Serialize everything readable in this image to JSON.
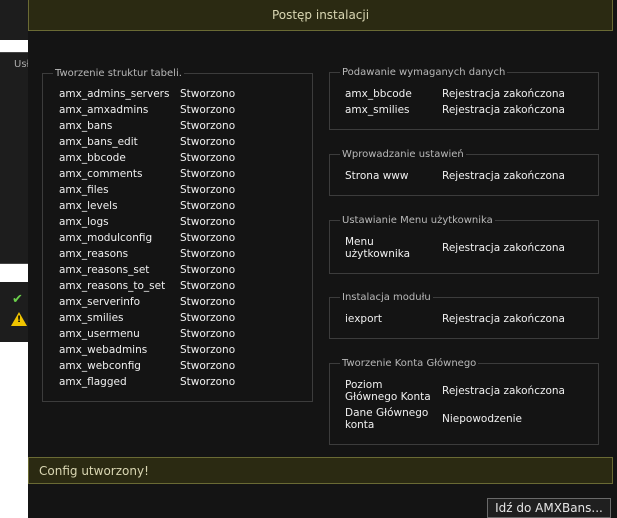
{
  "background": {
    "panel_label": "Usł"
  },
  "modal": {
    "title": "Postęp instalacji",
    "tables_group": {
      "legend": "Tworzenie struktur tabeli.",
      "rows": [
        {
          "name": "amx_admins_servers",
          "status": "Stworzono"
        },
        {
          "name": "amx_amxadmins",
          "status": "Stworzono"
        },
        {
          "name": "amx_bans",
          "status": "Stworzono"
        },
        {
          "name": "amx_bans_edit",
          "status": "Stworzono"
        },
        {
          "name": "amx_bbcode",
          "status": "Stworzono"
        },
        {
          "name": "amx_comments",
          "status": "Stworzono"
        },
        {
          "name": "amx_files",
          "status": "Stworzono"
        },
        {
          "name": "amx_levels",
          "status": "Stworzono"
        },
        {
          "name": "amx_logs",
          "status": "Stworzono"
        },
        {
          "name": "amx_modulconfig",
          "status": "Stworzono"
        },
        {
          "name": "amx_reasons",
          "status": "Stworzono"
        },
        {
          "name": "amx_reasons_set",
          "status": "Stworzono"
        },
        {
          "name": "amx_reasons_to_set",
          "status": "Stworzono"
        },
        {
          "name": "amx_serverinfo",
          "status": "Stworzono"
        },
        {
          "name": "amx_smilies",
          "status": "Stworzono"
        },
        {
          "name": "amx_usermenu",
          "status": "Stworzono"
        },
        {
          "name": "amx_webadmins",
          "status": "Stworzono"
        },
        {
          "name": "amx_webconfig",
          "status": "Stworzono"
        },
        {
          "name": "amx_flagged",
          "status": "Stworzono"
        }
      ]
    },
    "data_group": {
      "legend": "Podawanie wymaganych danych",
      "rows": [
        {
          "name": "amx_bbcode",
          "status": "Rejestracja zakończona"
        },
        {
          "name": "amx_smilies",
          "status": "Rejestracja zakończona"
        }
      ]
    },
    "settings_group": {
      "legend": "Wprowadzanie ustawień",
      "rows": [
        {
          "name": "Strona www",
          "status": "Rejestracja zakończona"
        }
      ]
    },
    "menu_group": {
      "legend": "Ustawianie Menu użytkownika",
      "rows": [
        {
          "name_line1": "Menu",
          "name_line2": "użytkownika",
          "status": "Rejestracja zakończona"
        }
      ]
    },
    "module_group": {
      "legend": "Instalacja modułu",
      "rows": [
        {
          "name": "iexport",
          "status": "Rejestracja zakończona"
        }
      ]
    },
    "account_group": {
      "legend": "Tworzenie Konta Głównego",
      "rows": [
        {
          "name_line1": "Poziom",
          "name_line2": "Głównego Konta",
          "status": "Rejestracja zakończona"
        },
        {
          "name_line1": "Dane Głównego",
          "name_line2": "konta",
          "status": "Niepowodzenie"
        }
      ]
    },
    "message": "Config utworzony!",
    "go_button": "Idź do AMXBans..."
  }
}
